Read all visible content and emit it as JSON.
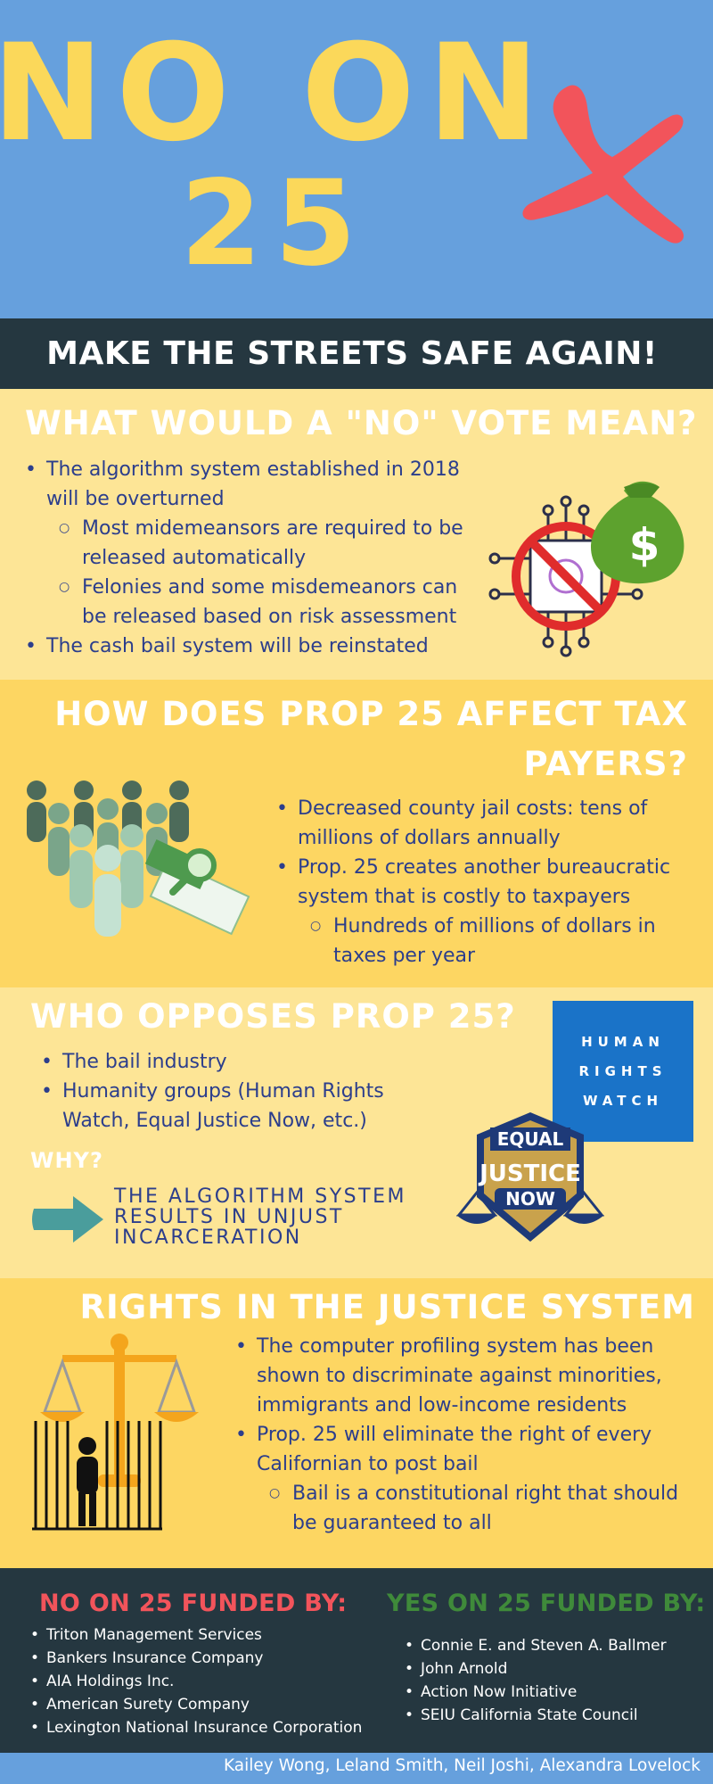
{
  "hero": {
    "line1": "NO ON",
    "line2": "25"
  },
  "banner": {
    "text": "MAKE THE STREETS SAFE AGAIN!"
  },
  "section1": {
    "heading": "WHAT WOULD A \"NO\" VOTE MEAN?",
    "items": [
      "The algorithm system established in 2018 will be overturned",
      "Most midemeansors are required to be released automatically",
      "Felonies and some misdemeanors can be released based on risk assessment",
      "The cash bail system will be reinstated"
    ]
  },
  "section2": {
    "heading_line1": "HOW DOES PROP 25 AFFECT TAX",
    "heading_line2": "PAYERS?",
    "items": [
      "Decreased county jail costs: tens of millions of dollars annually",
      "Prop. 25 creates another bureaucratic system that is costly to taxpayers",
      "Hundreds of millions of dollars in taxes per year"
    ]
  },
  "section3": {
    "heading": "WHO OPPOSES PROP 25?",
    "items": [
      "The bail industry",
      "Humanity groups (Human Rights Watch,  Equal Justice Now, etc.)"
    ],
    "why_label": "WHY?",
    "why_text": "THE ALGORITHM SYSTEM RESULTS IN UNJUST INCARCERATION",
    "hrw_logo": [
      "HUMAN",
      "RIGHTS",
      "WATCH"
    ],
    "ejn_logo": [
      "EQUAL",
      "JUSTICE",
      "NOW"
    ]
  },
  "section4": {
    "heading": "RIGHTS IN THE JUSTICE SYSTEM",
    "items": [
      "The computer profiling system has been shown to discriminate against minorities, immigrants and low-income residents",
      "Prop. 25 will eliminate the right of every Californian to post bail",
      "Bail is a constitutional right that should be guaranteed to all"
    ]
  },
  "funding": {
    "no_heading": "NO ON 25 FUNDED BY:",
    "no_items": [
      "Triton Management Services",
      "Bankers Insurance Company",
      "AIA Holdings Inc.",
      "American Surety Company",
      "Lexington National Insurance Corporation"
    ],
    "yes_heading": "YES ON 25 FUNDED BY:",
    "yes_items": [
      "Connie E. and Steven A. Ballmer",
      "John Arnold",
      "Action Now Initiative",
      "SEIU California State Council"
    ]
  },
  "footer": {
    "credits": "Kailey Wong, Leland Smith, Neil Joshi, Alexandra Lovelock"
  },
  "colors": {
    "blue": "#66a0dd",
    "yellow_light": "#fde596",
    "yellow": "#fdd662",
    "dark": "#253740",
    "navy_text": "#2c3e8c",
    "red": "#f2545b",
    "no_red": "#f2545b",
    "yes_green": "#3f8a3a"
  }
}
